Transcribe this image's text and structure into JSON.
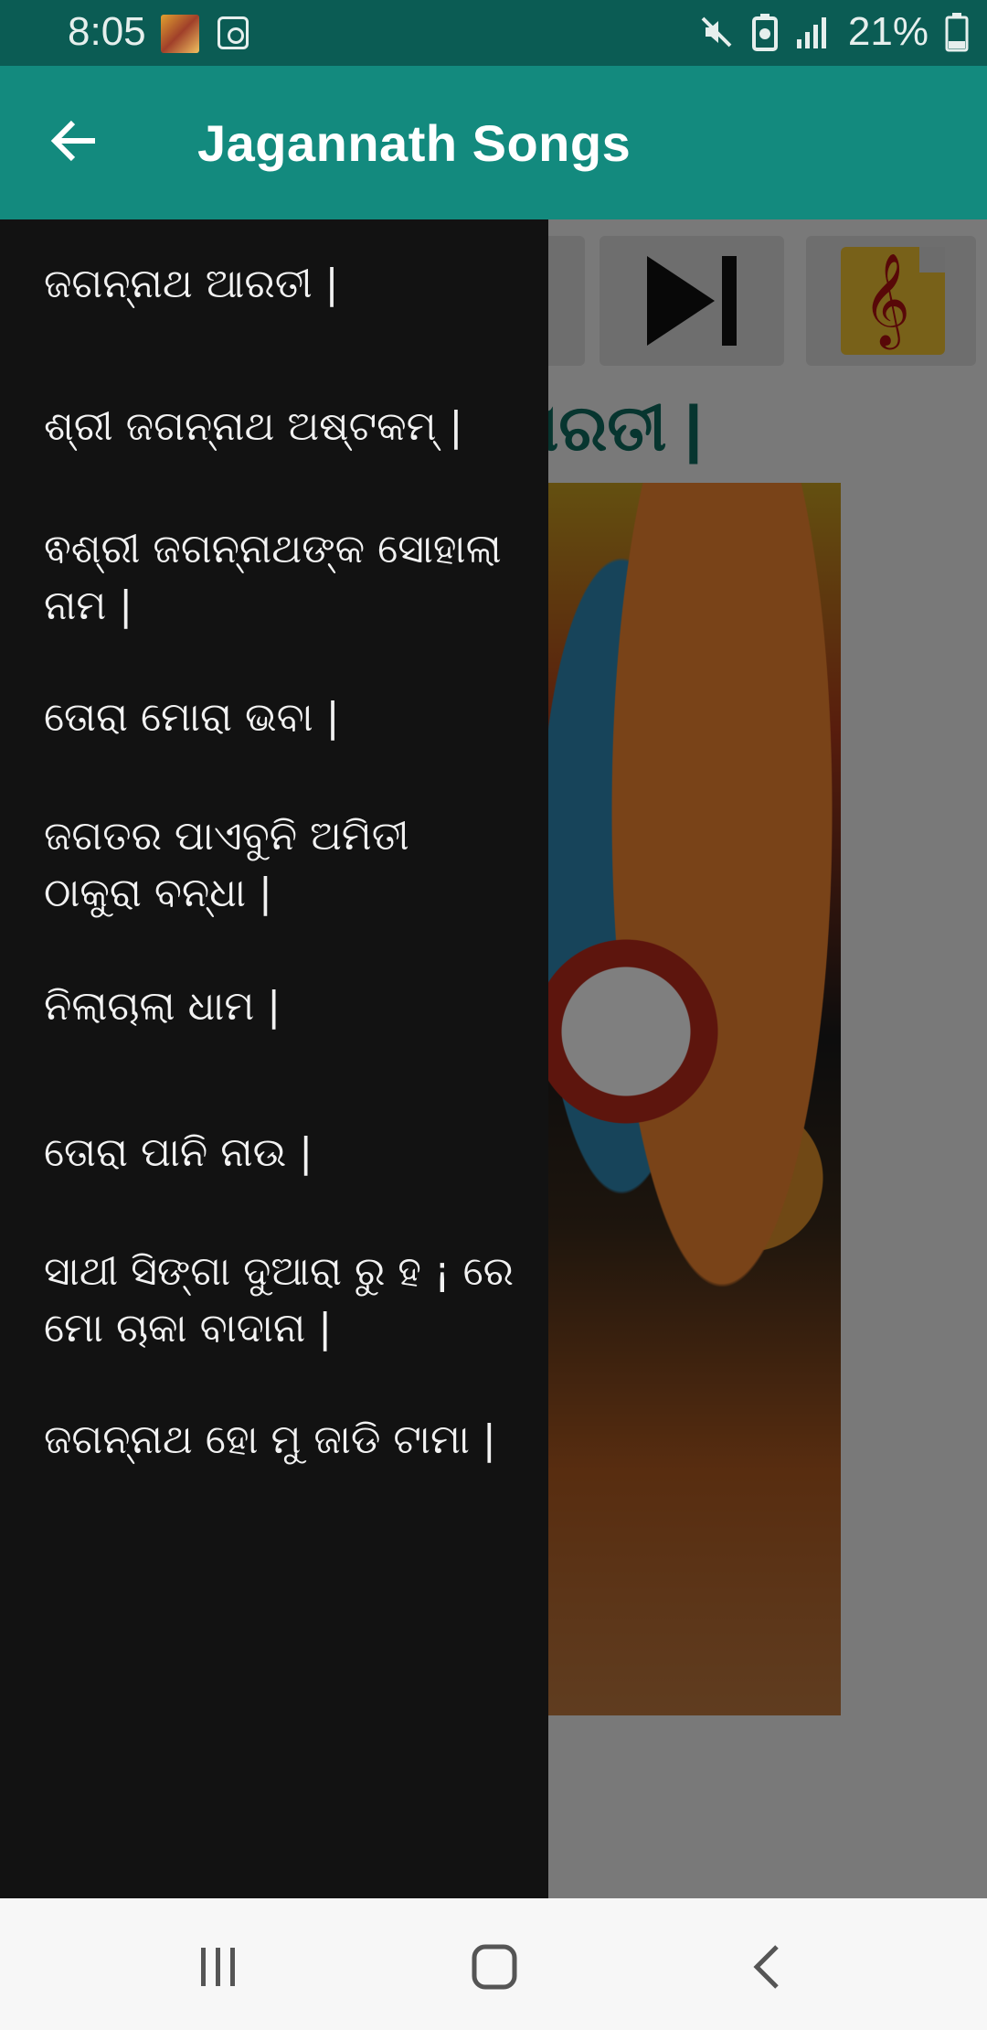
{
  "status_bar": {
    "time": "8:05",
    "battery_percent": "21%",
    "icons": [
      "photo-thumbnail-icon",
      "media-app-icon",
      "mute-icon",
      "battery-saver-icon",
      "signal-icon",
      "battery-icon"
    ]
  },
  "app_bar": {
    "title": "Jagannath Songs",
    "back_icon": "arrow-left-icon",
    "color": "#138a7e"
  },
  "drawer": {
    "items": [
      "ଜଗନ୍ନାଥ ଆରତୀ |",
      "ଶ୍ରୀ ଜଗନ୍ନାଥ ଅଷ୍ଟକମ୍ |",
      "ଵଶ୍ରୀ ଜଗନ୍ନାଥଙ୍କ ସୋହାଲା ନାମ |",
      "ତୋରା ମୋରା ଭବା |",
      "ଜଗତର ପାଏବୁନି ଅମିତୀ ଠାକୁରା ବନ୍ଧା |",
      "ନିଲାଚାଲା ଧାମ |",
      "ତୋରା ପାନି ନାଉ |",
      "ସାଥୀ ସିଙ୍ଗା ଦୁଆରା ରୁ ହ ¡ ରେ ମୋ ଚାକା ବାଦାନା |",
      "ଜଗନ୍ନାଥ ହୋ ମୁ ଜାଡି ଟାମା |"
    ]
  },
  "background": {
    "title_fragment": "ାରତୀ |",
    "controls": [
      "previous-button",
      "next-button",
      "lyrics-button"
    ]
  },
  "nav_bar": {
    "buttons": [
      "recent-apps-icon",
      "home-icon",
      "back-icon"
    ]
  }
}
